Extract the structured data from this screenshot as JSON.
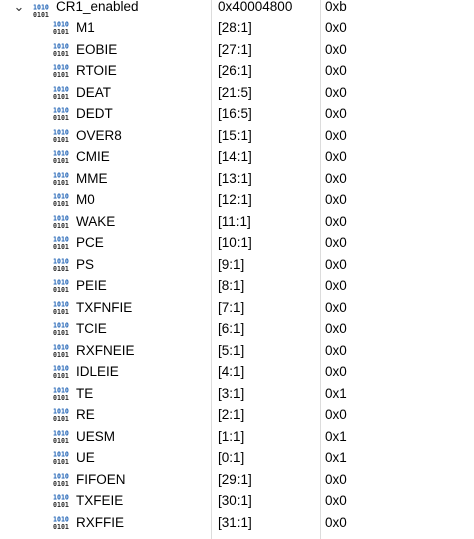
{
  "icons": {
    "expand": "chevron-down-icon",
    "register": "binary-register-icon",
    "field": "binary-field-icon"
  },
  "colors": {
    "icon_ones": "#1a5fb4",
    "icon_zeros": "#2a2a2a",
    "separator": "#dcdcdc"
  },
  "register": {
    "name": "CR1_enabled",
    "address": "0x40004800",
    "value": "0xb",
    "expanded": true
  },
  "fields": [
    {
      "name": "M1",
      "bits": "[28:1]",
      "value": "0x0"
    },
    {
      "name": "EOBIE",
      "bits": "[27:1]",
      "value": "0x0"
    },
    {
      "name": "RTOIE",
      "bits": "[26:1]",
      "value": "0x0"
    },
    {
      "name": "DEAT",
      "bits": "[21:5]",
      "value": "0x0"
    },
    {
      "name": "DEDT",
      "bits": "[16:5]",
      "value": "0x0"
    },
    {
      "name": "OVER8",
      "bits": "[15:1]",
      "value": "0x0"
    },
    {
      "name": "CMIE",
      "bits": "[14:1]",
      "value": "0x0"
    },
    {
      "name": "MME",
      "bits": "[13:1]",
      "value": "0x0"
    },
    {
      "name": "M0",
      "bits": "[12:1]",
      "value": "0x0"
    },
    {
      "name": "WAKE",
      "bits": "[11:1]",
      "value": "0x0"
    },
    {
      "name": "PCE",
      "bits": "[10:1]",
      "value": "0x0"
    },
    {
      "name": "PS",
      "bits": "[9:1]",
      "value": "0x0"
    },
    {
      "name": "PEIE",
      "bits": "[8:1]",
      "value": "0x0"
    },
    {
      "name": "TXFNFIE",
      "bits": "[7:1]",
      "value": "0x0"
    },
    {
      "name": "TCIE",
      "bits": "[6:1]",
      "value": "0x0"
    },
    {
      "name": "RXFNEIE",
      "bits": "[5:1]",
      "value": "0x0"
    },
    {
      "name": "IDLEIE",
      "bits": "[4:1]",
      "value": "0x0"
    },
    {
      "name": "TE",
      "bits": "[3:1]",
      "value": "0x1"
    },
    {
      "name": "RE",
      "bits": "[2:1]",
      "value": "0x0"
    },
    {
      "name": "UESM",
      "bits": "[1:1]",
      "value": "0x1"
    },
    {
      "name": "UE",
      "bits": "[0:1]",
      "value": "0x1"
    },
    {
      "name": "FIFOEN",
      "bits": "[29:1]",
      "value": "0x0"
    },
    {
      "name": "TXFEIE",
      "bits": "[30:1]",
      "value": "0x0"
    },
    {
      "name": "RXFFIE",
      "bits": "[31:1]",
      "value": "0x0"
    }
  ]
}
